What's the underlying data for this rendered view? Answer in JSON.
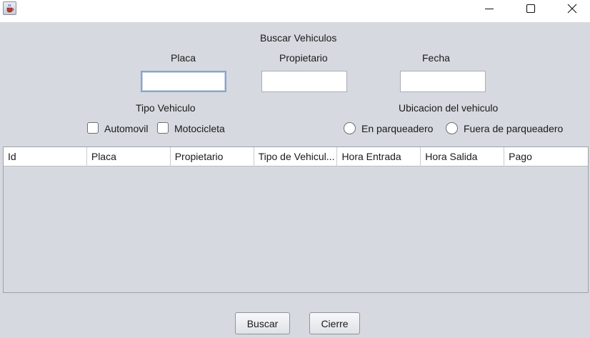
{
  "window": {
    "icon": "java-cup-icon",
    "controls": [
      "minimize-icon",
      "maximize-icon",
      "close-icon"
    ]
  },
  "form": {
    "title": "Buscar Vehiculos",
    "placa_label": "Placa",
    "propietario_label": "Propietario",
    "fecha_label": "Fecha",
    "placa_value": "",
    "propietario_value": "",
    "fecha_value": "",
    "tipo_label": "Tipo Vehiculo",
    "automovil_label": "Automovil",
    "motocicleta_label": "Motocicleta",
    "ubicacion_label": "Ubicacion del vehiculo",
    "en_parqueadero_label": "En parqueadero",
    "fuera_parqueadero_label": "Fuera de parqueadero"
  },
  "table": {
    "columns": [
      "Id",
      "Placa",
      "Propietario",
      "Tipo de Vehicul...",
      "Hora Entrada",
      "Hora Salida",
      "Pago"
    ],
    "rows": []
  },
  "buttons": {
    "buscar": "Buscar",
    "cierre": "Cierre"
  }
}
